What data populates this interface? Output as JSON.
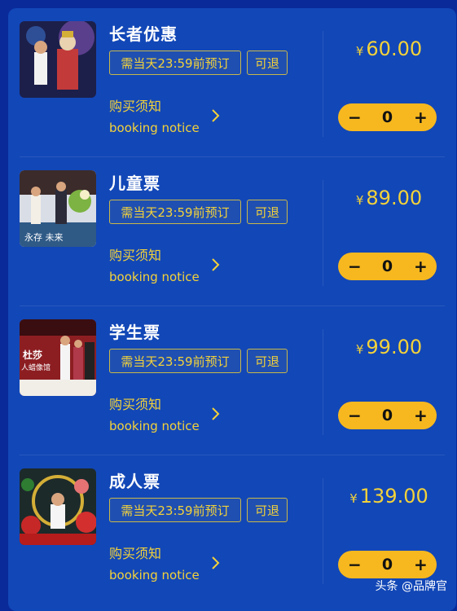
{
  "tickets": [
    {
      "name": "长者优惠",
      "deadline": "需当天23:59前预订",
      "refund": "可退",
      "notice_cn": "购买须知",
      "notice_en": "booking notice",
      "currency": "¥",
      "price": "60.00",
      "qty": "0",
      "minus": "−",
      "plus": "+"
    },
    {
      "name": "儿童票",
      "deadline": "需当天23:59前预订",
      "refund": "可退",
      "notice_cn": "购买须知",
      "notice_en": "booking notice",
      "currency": "¥",
      "price": "89.00",
      "qty": "0",
      "minus": "−",
      "plus": "+"
    },
    {
      "name": "学生票",
      "deadline": "需当天23:59前预订",
      "refund": "可退",
      "notice_cn": "购买须知",
      "notice_en": "booking notice",
      "currency": "¥",
      "price": "99.00",
      "qty": "0",
      "minus": "−",
      "plus": "+"
    },
    {
      "name": "成人票",
      "deadline": "需当天23:59前预订",
      "refund": "可退",
      "notice_cn": "购买须知",
      "notice_en": "booking notice",
      "currency": "¥",
      "price": "139.00",
      "qty": "0",
      "minus": "−",
      "plus": "+"
    }
  ],
  "watermark": "头条 @品牌官",
  "colors": {
    "panel": "#1247b7",
    "accent_text": "#f3d23a",
    "stepper": "#f7b81f",
    "background": "#0a2a9a"
  }
}
